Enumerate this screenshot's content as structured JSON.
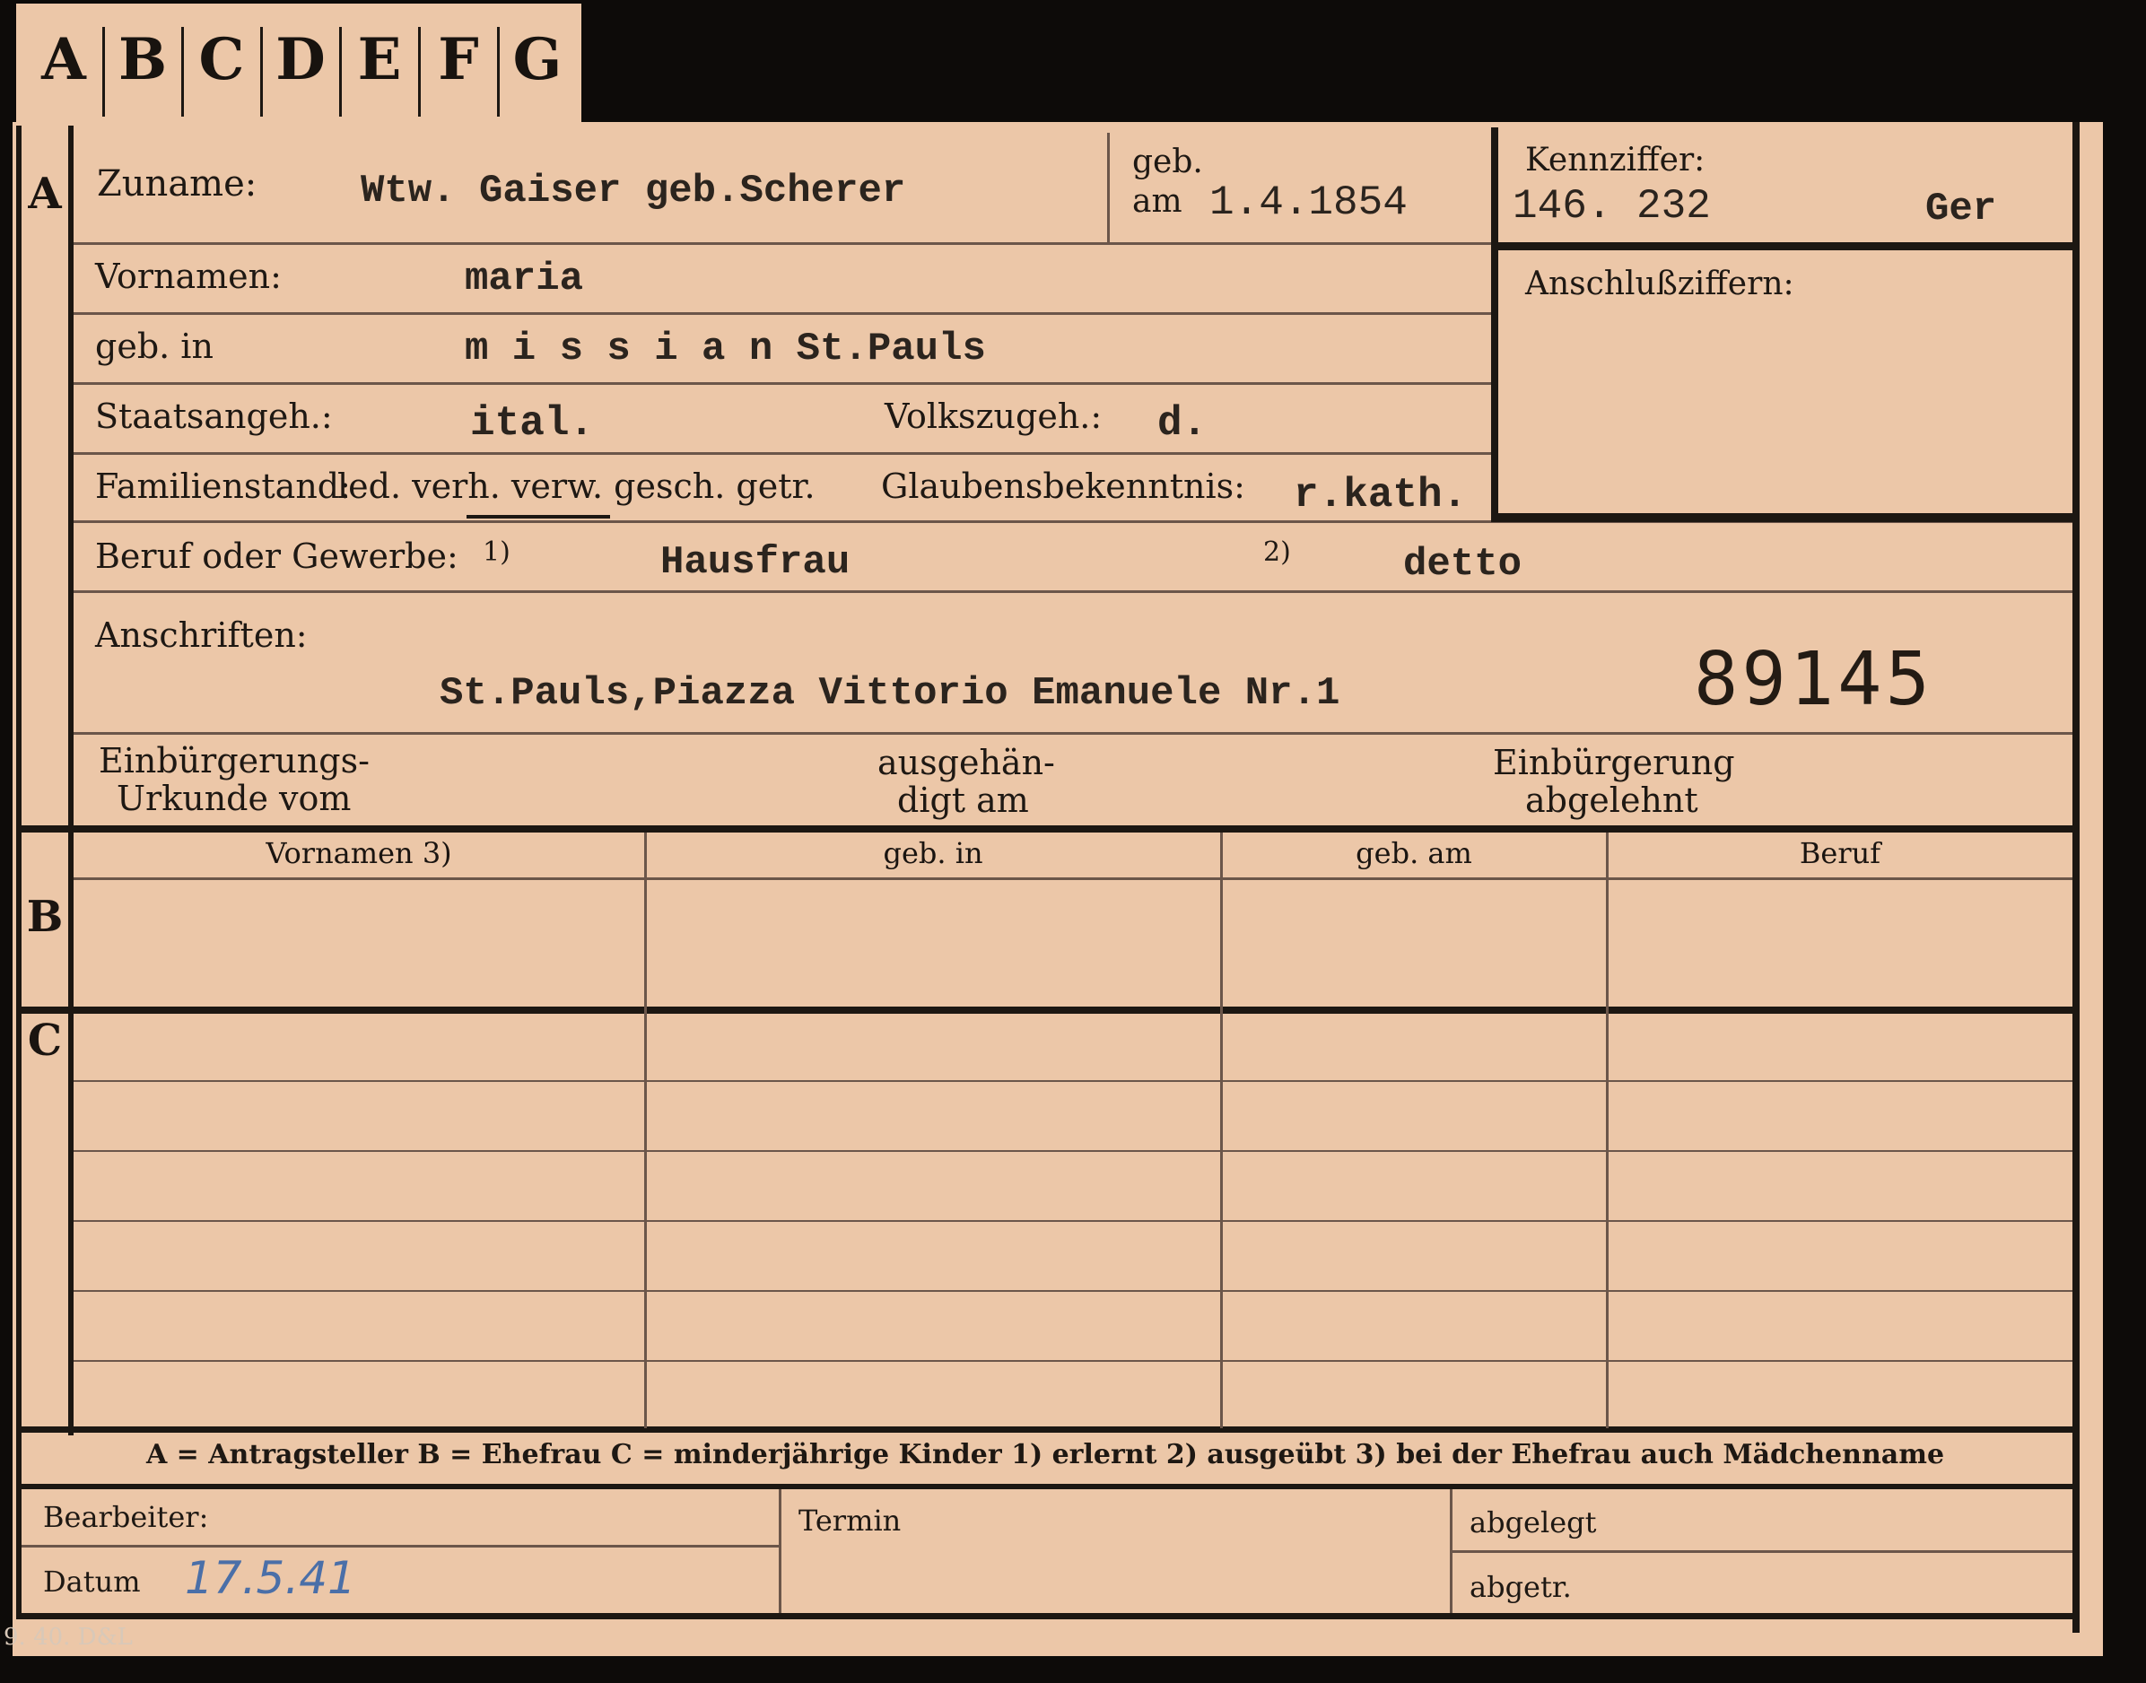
{
  "tabs": [
    "A",
    "B",
    "C",
    "D",
    "E",
    "F",
    "G"
  ],
  "section_letters": {
    "a": "A",
    "b": "B",
    "c": "C"
  },
  "form": {
    "zuname_label": "Zuname:",
    "zuname_value": "Wtw. Gaiser geb.Scherer",
    "geb_label_1": "geb.",
    "geb_label_2": "am",
    "geb_am_value": "1.4.1854",
    "kennziffer_label": "Kennziffer:",
    "kennziffer_value": "146. 232",
    "kennziffer_code": "Ger",
    "anschluss_label": "Anschlußziffern:",
    "vornamen_label": "Vornamen:",
    "vornamen_value": "maria",
    "geb_in_label": "geb. in",
    "geb_in_value": "m i s s i a n St.Pauls",
    "staats_label": "Staatsangeh.:",
    "staats_value": "ital.",
    "volks_label": "Volkszugeh.:",
    "volks_value": "d.",
    "familien_label": "Familienstand:",
    "familien_options": "led. verh. verw. gesch. getr.",
    "glauben_label": "Glaubensbekenntnis:",
    "glauben_value": "r.kath.",
    "beruf_label": "Beruf oder Gewerbe:",
    "beruf_note1": "1)",
    "beruf_value1": "Hausfrau",
    "beruf_note2": "2)",
    "beruf_value2": "detto",
    "anschriften_label": "Anschriften:",
    "anschriften_value": "St.Pauls,Piazza Vittorio Emanuele Nr.1",
    "stamp_number": "89145",
    "einb_urkunde_1": "Einbürgerungs-",
    "einb_urkunde_2": "Urkunde vom",
    "ausgehaend_1": "ausgehän-",
    "ausgehaend_2": "digt am",
    "einb_abgelehnt_1": "Einbürgerung",
    "einb_abgelehnt_2": "abgelehnt"
  },
  "table": {
    "headers": [
      "Vornamen 3)",
      "geb. in",
      "geb. am",
      "Beruf"
    ]
  },
  "legend": "A = Antragsteller   B = Ehefrau   C = minderjährige Kinder   1) erlernt   2) ausgeübt   3) bei der Ehefrau auch Mädchenname",
  "footer": {
    "bearbeiter_label": "Bearbeiter:",
    "datum_label": "Datum",
    "datum_value": "17.5.41",
    "termin_label": "Termin",
    "abgelegt_label": "abgelegt",
    "abgetr_label": "abgetr.",
    "print_code": "9. 40. D&L"
  }
}
